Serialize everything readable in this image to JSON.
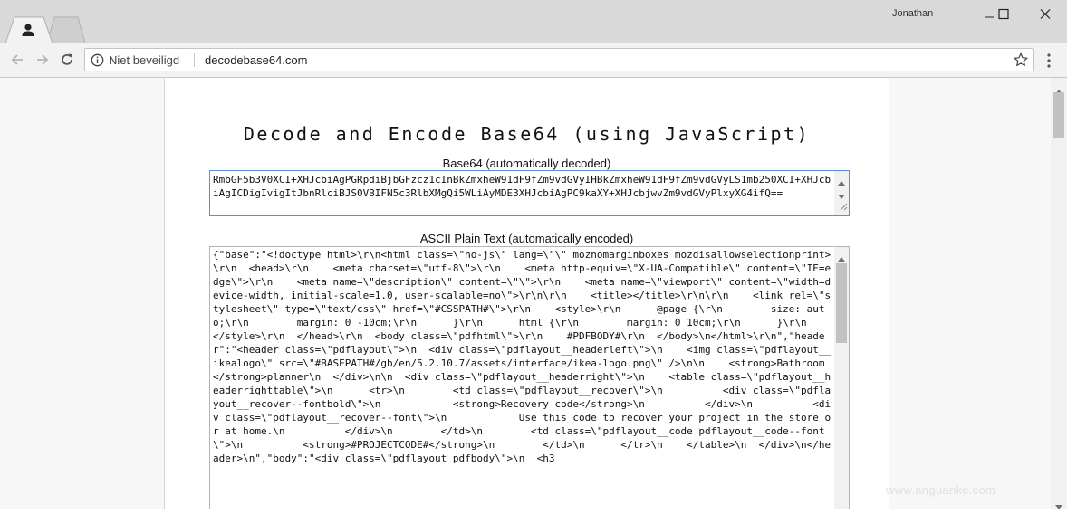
{
  "window": {
    "user_name": "Jonathan",
    "controls": [
      "minimize-icon",
      "maximize-icon",
      "close-icon"
    ]
  },
  "tabs": [
    {
      "icon": "person-icon",
      "active": true
    },
    {
      "icon": "",
      "active": false
    }
  ],
  "toolbar": {
    "security_label": "Niet beveiligd",
    "url": "decodebase64.com",
    "icons": [
      "back-icon",
      "forward-icon",
      "reload-icon",
      "info-icon",
      "star-icon",
      "menu-icon"
    ]
  },
  "page": {
    "heading": "Decode and Encode Base64 (using JavaScript)",
    "base64_label": "Base64 (automatically decoded)",
    "base64_value": "RmbGF5b3V0XCI+XHJcbiAgPGRpdiBjbGFzcz1cInBkZmxheW91dF9fZm9vdGVyIHBkZmxheW91dF9fZm9vdGVyLS1mb250XCI+XHJcbiAgICDigIvigItJbnRlciBJS0VBIFN5c3RlbXMgQi5WLiAyMDE3XHJcbiAgPC9kaXY+XHJcbjwvZm9vdGVyPlxyXG4ifQ==",
    "ascii_label": "ASCII Plain Text (automatically encoded)",
    "ascii_value": "{\"base\":\"<!doctype html>\\r\\n<html class=\\\"no-js\\\" lang=\\\"\\\" moznomarginboxes mozdisallowselectionprint>\\r\\n  <head>\\r\\n    <meta charset=\\\"utf-8\\\">\\r\\n    <meta http-equiv=\\\"X-UA-Compatible\\\" content=\\\"IE=edge\\\">\\r\\n    <meta name=\\\"description\\\" content=\\\"\\\">\\r\\n    <meta name=\\\"viewport\\\" content=\\\"width=device-width, initial-scale=1.0, user-scalable=no\\\">\\r\\n\\r\\n    <title></title>\\r\\n\\r\\n    <link rel=\\\"stylesheet\\\" type=\\\"text/css\\\" href=\\\"#CSSPATH#\\\">\\r\\n    <style>\\r\\n      @page {\\r\\n        size: auto;\\r\\n        margin: 0 -10cm;\\r\\n      }\\r\\n      html {\\r\\n        margin: 0 10cm;\\r\\n      }\\r\\n    </style>\\r\\n  </head>\\r\\n  <body class=\\\"pdfhtml\\\">\\r\\n    #PDFBODY#\\r\\n  </body>\\n</html>\\r\\n\",\"header\":\"<header class=\\\"pdflayout\\\">\\n  <div class=\\\"pdflayout__headerleft\\\">\\n    <img class=\\\"pdflayout__ikealogo\\\" src=\\\"#BASEPATH#/gb/en/5.2.10.7/assets/interface/ikea-logo.png\\\" />\\n\\n    <strong>Bathroom</strong>planner\\n  </div>\\n\\n  <div class=\\\"pdflayout__headerright\\\">\\n    <table class=\\\"pdflayout__headerrighttable\\\">\\n      <tr>\\n        <td class=\\\"pdflayout__recover\\\">\\n          <div class=\\\"pdflayout__recover--fontbold\\\">\\n            <strong>Recovery code</strong>\\n          </div>\\n          <div class=\\\"pdflayout__recover--font\\\">\\n            Use this code to recover your project in the store or at home.\\n          </div>\\n        </td>\\n        <td class=\\\"pdflayout__code pdflayout__code--font\\\">\\n          <strong>#PROJECTCODE#</strong>\\n        </td>\\n      </tr>\\n    </table>\\n  </div>\\n</header>\\n\",\"body\":\"<div class=\\\"pdflayout pdfbody\\\">\\n  <h3"
  },
  "watermark": "www.anguanke.com"
}
